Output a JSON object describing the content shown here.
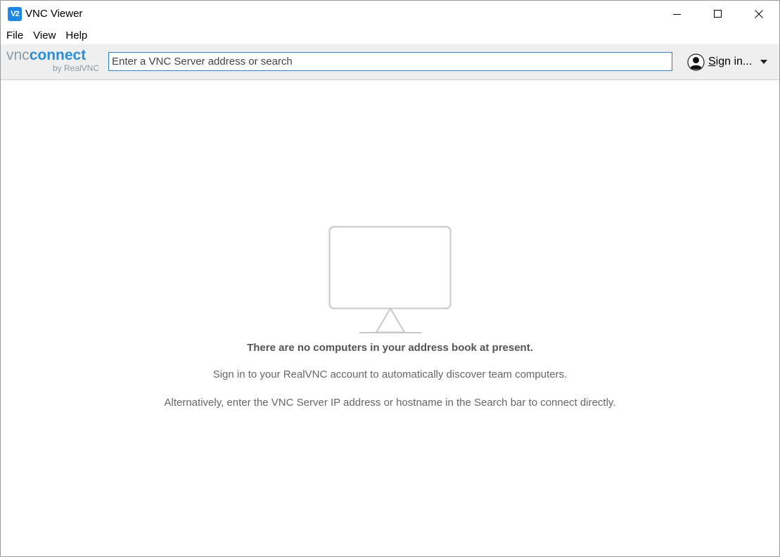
{
  "window": {
    "title": "VNC Viewer",
    "icon_text": "V2"
  },
  "menu": {
    "items": [
      "File",
      "View",
      "Help"
    ]
  },
  "toolbar": {
    "logo": {
      "vnc": "vnc",
      "connect": "connect",
      "byline": "by RealVNC"
    },
    "search": {
      "placeholder": "Enter a VNC Server address or search",
      "value": ""
    },
    "signin": {
      "first_letter": "S",
      "rest": "ign in...",
      "avatar_icon": "user-avatar-icon",
      "dropdown_icon": "chevron-down-icon"
    }
  },
  "empty_state": {
    "icon": "monitor-icon",
    "title": "There are no computers in your address book at present.",
    "line1": "Sign in to your RealVNC account to automatically discover team computers.",
    "line2": "Alternatively, enter the VNC Server IP address or hostname in the Search bar to connect directly."
  },
  "colors": {
    "accent": "#2b83c6",
    "logo_blue": "#2a8fd6",
    "logo_gray": "#8a9aa6",
    "toolbar_bg": "#efefef"
  }
}
